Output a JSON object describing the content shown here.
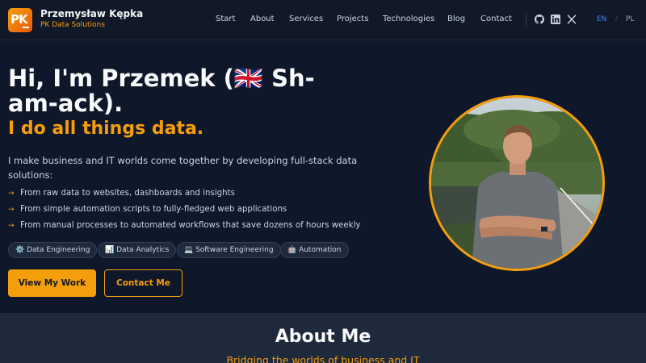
{
  "brand": {
    "logo_text": "PK",
    "name": "Przemysław Kępka",
    "subtitle": "PK Data Solutions"
  },
  "nav": {
    "items": [
      "Start",
      "About",
      "Services",
      "Projects",
      "Technologies",
      "Blog",
      "Contact"
    ]
  },
  "social": [
    "github-icon",
    "linkedin-icon",
    "x-icon"
  ],
  "languages": {
    "en": "EN",
    "divider": "/",
    "pl": "PL",
    "active": "EN"
  },
  "hero": {
    "heading": "Hi, I'm Przemek (🇬🇧 Sh-am-ack).",
    "tagline": "I do all things data.",
    "intro": "I make business and IT worlds come together by developing full-stack data solutions:",
    "bullets": [
      "From raw data to websites, dashboards and insights",
      "From simple automation scripts to fully-fledged web applications",
      "From manual processes to automated workflows that save dozens of hours weekly"
    ],
    "tags": [
      "⚙️ Data Engineering",
      "📊 Data Analytics",
      "💻 Software Engineering",
      "🤖 Automation"
    ],
    "primary_button": "View My Work",
    "secondary_button": "Contact Me"
  },
  "about": {
    "title": "About Me",
    "subtitle": "Bridging the worlds of business and IT"
  },
  "colors": {
    "accent": "#f59e0b",
    "background": "#0f172a",
    "nav_bg": "#111827",
    "section_bg": "#1e293b"
  }
}
